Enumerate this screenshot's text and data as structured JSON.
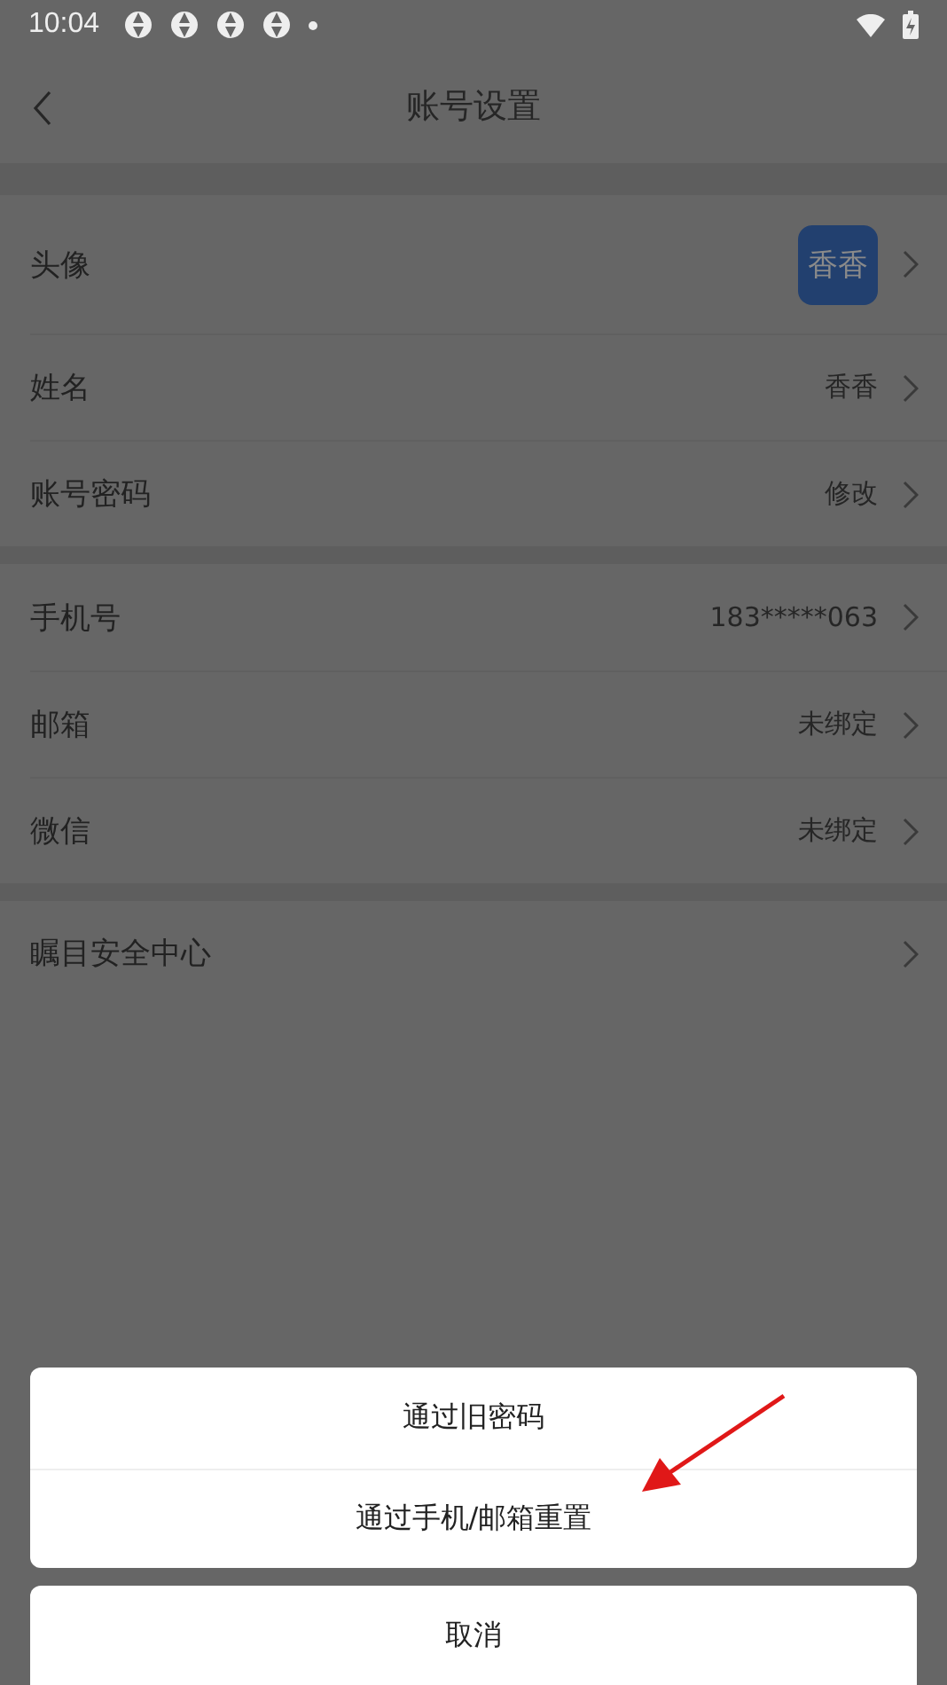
{
  "status_bar": {
    "time": "10:04",
    "notification_icons": [
      {
        "kind": "app"
      },
      {
        "kind": "app"
      },
      {
        "kind": "app"
      },
      {
        "kind": "app"
      },
      {
        "kind": "dot"
      }
    ]
  },
  "header": {
    "title": "账号设置"
  },
  "sections": [
    {
      "rows": [
        {
          "kind": "avatar",
          "label": "头像",
          "avatar_text": "香香"
        },
        {
          "kind": "value",
          "label": "姓名",
          "value": "香香"
        },
        {
          "kind": "value",
          "label": "账号密码",
          "value": "修改"
        }
      ]
    },
    {
      "rows": [
        {
          "kind": "value",
          "label": "手机号",
          "value": "183*****063"
        },
        {
          "kind": "value",
          "label": "邮箱",
          "value": "未绑定"
        },
        {
          "kind": "value",
          "label": "微信",
          "value": "未绑定"
        }
      ]
    },
    {
      "rows": [
        {
          "kind": "plain",
          "label": "瞩目安全中心"
        }
      ]
    }
  ],
  "action_sheet": {
    "options": [
      "通过旧密码",
      "通过手机/邮箱重置"
    ],
    "cancel": "取消"
  }
}
